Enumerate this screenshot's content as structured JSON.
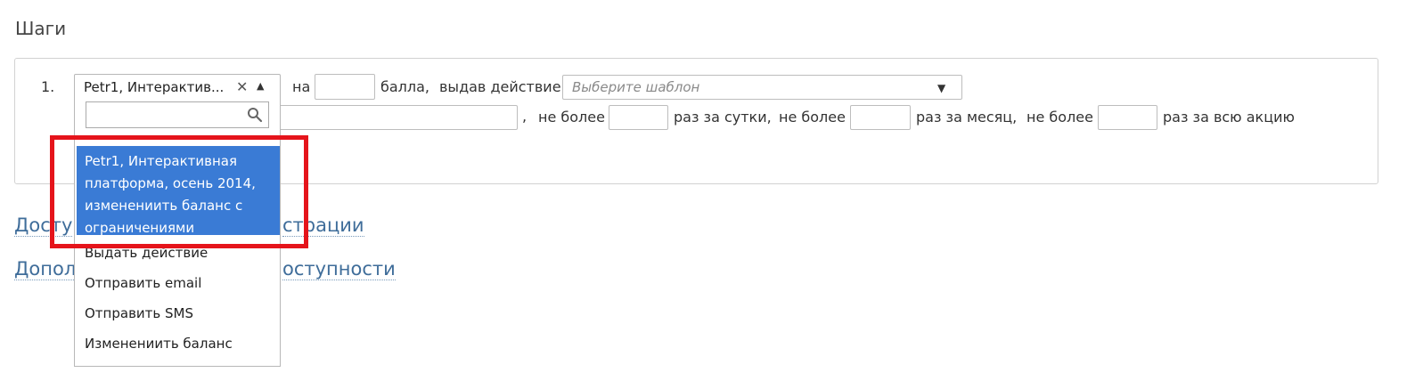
{
  "section": {
    "title": "Шаги"
  },
  "step": {
    "number": "1.",
    "action_select_value": "Petr1, Интерактив...",
    "clear_symbol": "✕",
    "label_na": "на",
    "label_points": "балла,",
    "label_issue_action": "выдав действие",
    "template_placeholder": "Выберите шаблон",
    "comma": ",",
    "label_not_more": "не более",
    "label_per_day": "раз за сутки,",
    "label_per_month": "раз за месяц,",
    "label_per_campaign": "раз за всю акцию"
  },
  "dropdown": {
    "search_value": "",
    "highlighted_option": "Petr1, Интерактивная платформа, осень 2014, изменениить баланс с ограничениями",
    "options": [
      "Выдать действие",
      "Отправить email",
      "Отправить SMS",
      "Изменениить баланс"
    ]
  },
  "links": {
    "availability_left": "Досту",
    "availability_right": "страции",
    "additional_left": "Допол",
    "additional_right": "оступности"
  },
  "colors": {
    "highlight_bg": "#3a7bd5",
    "annotation_border": "#e5141b",
    "link": "#3f6d9a"
  },
  "icons": {
    "clear": "close-icon",
    "collapse": "chevron-up-icon",
    "search": "search-icon",
    "template_expand": "chevron-down-icon"
  }
}
